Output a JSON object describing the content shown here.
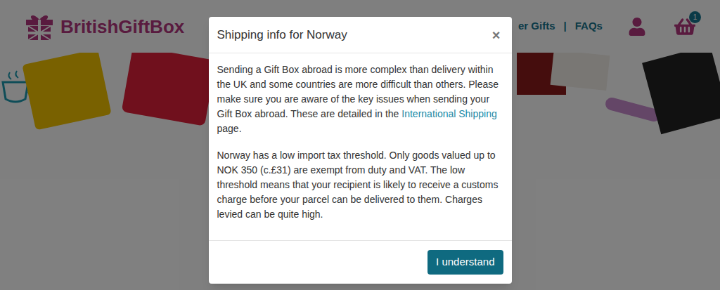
{
  "header": {
    "logo": "BritishGiftBox",
    "nav": [
      {
        "label": "er Gifts"
      },
      {
        "label": "FAQs"
      }
    ],
    "separator": "|",
    "cart_count": "1"
  },
  "dialog": {
    "title": "Shipping info for Norway",
    "close": "×",
    "paragraphs": [
      [
        {
          "text": "Sending a Gift Box abroad is more complex than delivery within the UK and some countries are more difficult than others. Please make sure you are aware of the key issues when sending your Gift Box abroad. These are detailed in the ",
          "link": false
        },
        {
          "text": "International Shipping",
          "link": true
        },
        {
          "text": " page.",
          "link": false
        }
      ],
      [
        {
          "text": "Norway has a low import tax threshold. Only goods valued up to NOK 350 (c.£31) are exempt from duty and VAT. The low threshold means that your recipient is likely to receive a customs charge before your parcel can be delivered to them. Charges levied can be quite high.",
          "link": false
        }
      ]
    ],
    "button": "I understand"
  }
}
